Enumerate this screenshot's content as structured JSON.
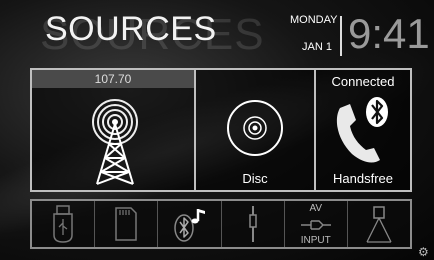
{
  "header": {
    "title": "SOURCES",
    "day": "MONDAY",
    "date": "JAN 1",
    "time": "9:41"
  },
  "tiles": {
    "radio": {
      "frequency": "107.70",
      "icon": "radio-tower-icon"
    },
    "disc": {
      "label": "Disc",
      "icon": "disc-icon"
    },
    "handsfree": {
      "status": "Connected",
      "label": "Handsfree",
      "icon": "bluetooth-phone-icon"
    }
  },
  "bottom_bar": {
    "items": [
      {
        "icon": "usb-icon"
      },
      {
        "icon": "sd-card-icon"
      },
      {
        "icon": "bluetooth-audio-icon"
      },
      {
        "icon": "aux-jack-icon"
      },
      {
        "top_label": "AV",
        "bottom_label": "INPUT",
        "icon": "av-input-icon"
      },
      {
        "icon": "camera-icon"
      }
    ]
  },
  "colors": {
    "background": "#0a0a0a",
    "tile_border": "#bfbfbf",
    "frequency_bar": "#4a4a4a"
  }
}
